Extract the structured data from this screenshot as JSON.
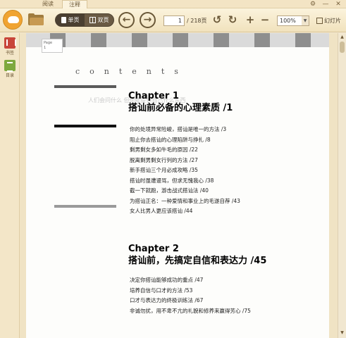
{
  "tabs": [
    {
      "label": "阅读"
    },
    {
      "label": "注释"
    }
  ],
  "window_controls": {
    "menu": "⚙",
    "minimize": "—",
    "close": "✕"
  },
  "toolbar": {
    "single_page_label": "单页",
    "double_page_label": "双页",
    "current_page": "1",
    "total_pages": "/ 218页",
    "zoom": "100%",
    "slideshow_label": "幻灯片"
  },
  "sidebar": {
    "items": [
      {
        "label": "书签"
      },
      {
        "label": "目录"
      }
    ]
  },
  "page": {
    "page_label": "Page\n1",
    "contents_title": "contents",
    "ghost_text": "人们会问什么  但你能提供自己什么东西",
    "chapters": [
      {
        "title": "Chapter 1",
        "subtitle": "搭讪前必备的心理素质 /1",
        "entries": [
          "你的处境异常险峻，搭讪是唯一的方法 /3",
          "阻止你去搭讪的心理陷阱与挣扎 /8",
          "剩男剩女多如牛毛的原因 /22",
          "脱离剩男剩女行列的方法 /27",
          "新手搭讪三个月必成攻略 /35",
          "搭讪时虽遭谩骂，但求无愧我心 /38",
          "截一下就跑，游击战式搭讪法 /40",
          "为搭讪正名：一种爱情和事业上的毛遂自荐 /43",
          "女人比男人更应该搭讪 /44"
        ]
      },
      {
        "title": "Chapter 2",
        "subtitle": "搭讪前，先搞定自信和表达力 /45",
        "entries": [
          "决定你搭讪能够成功的重点 /47",
          "培养自信与口才的方法 /53",
          "口才与表达力的终极训练法 /67",
          "非诚勿扰，用不卑不亢的礼貌和修养来赢得芳心 /75"
        ]
      }
    ]
  },
  "colors": {
    "chrome_bg": "#f5ead2",
    "accent_orange": "#f0a432",
    "bookmark_red": "#c8463a",
    "toc_green": "#7ea83e"
  }
}
